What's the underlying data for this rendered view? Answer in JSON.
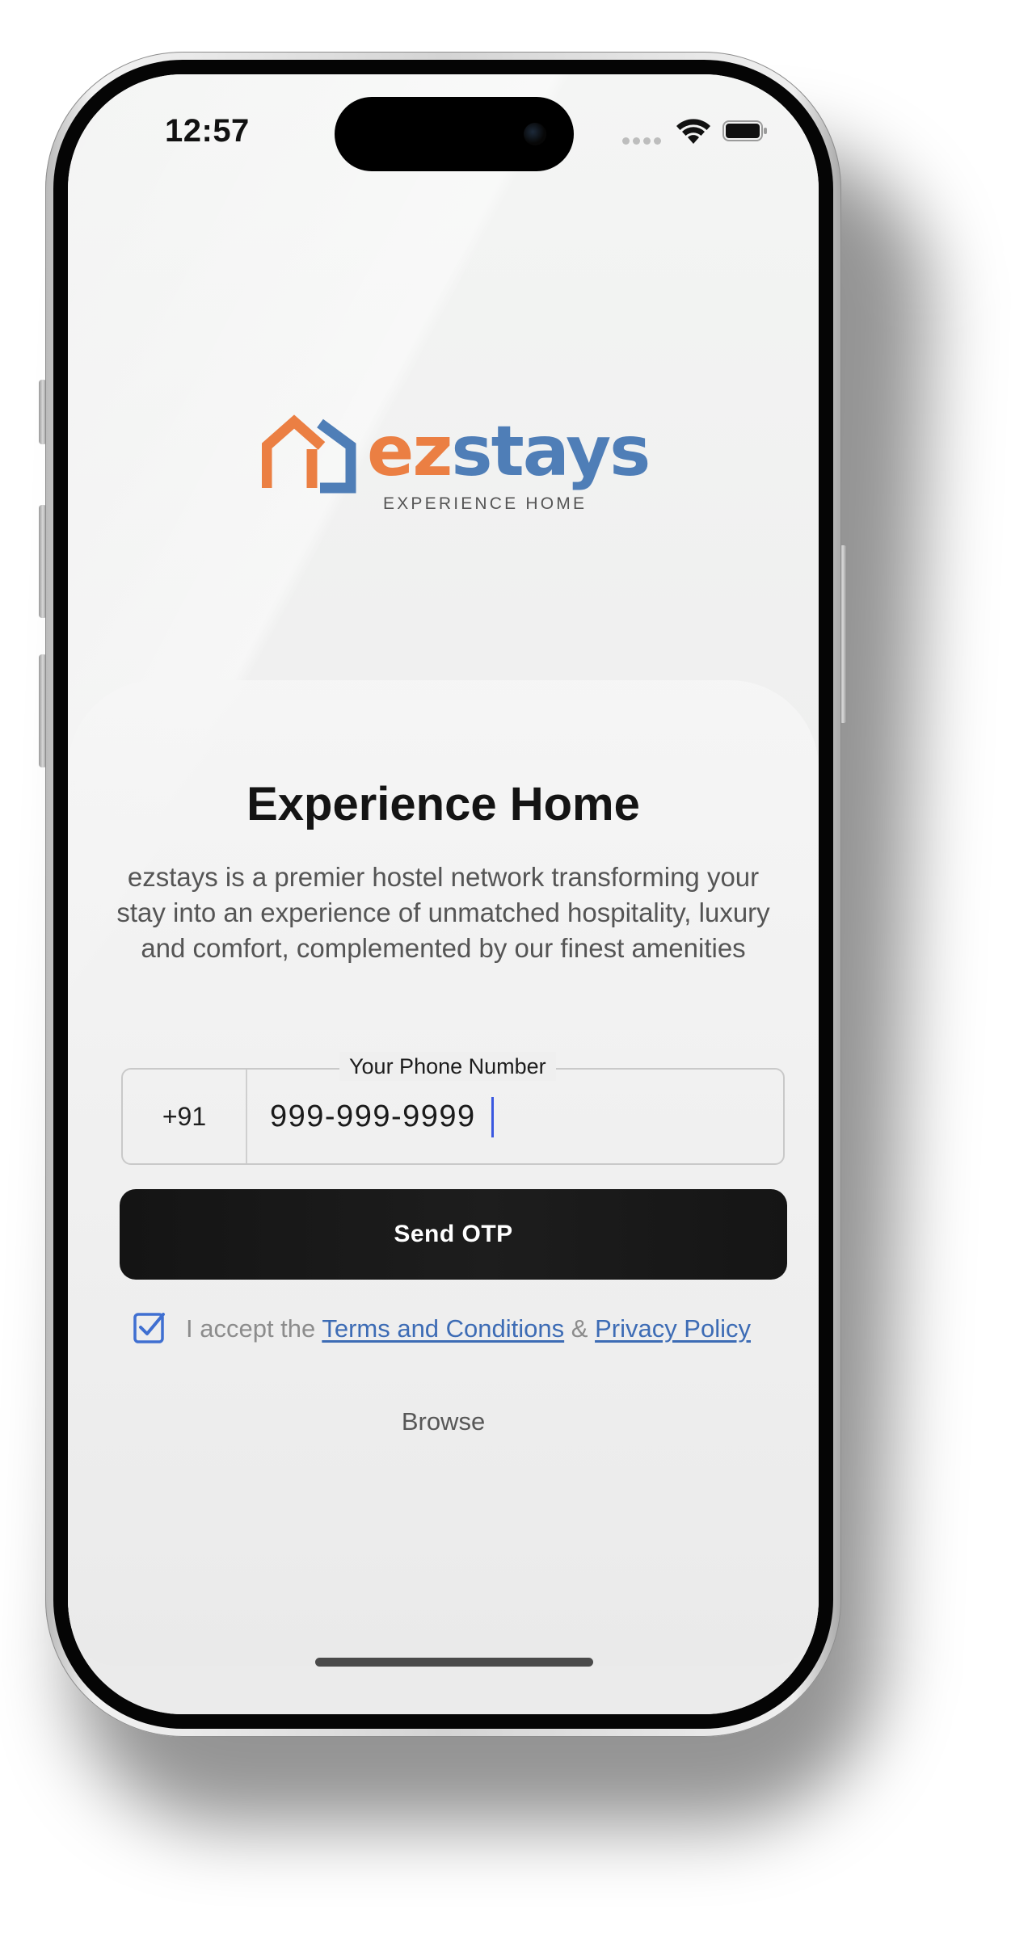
{
  "status_bar": {
    "time": "12:57"
  },
  "logo": {
    "wordmark_part1": "ez",
    "wordmark_part2": "stays",
    "tagline": "EXPERIENCE HOME"
  },
  "main": {
    "title": "Experience Home",
    "description": "ezstays is a premier hostel network transforming your stay into an experience of unmatched hospitality, luxury and comfort, complemented by our finest amenities"
  },
  "phone_field": {
    "label": "Your Phone Number",
    "country_code": "+91",
    "value": "999-999-9999"
  },
  "send_button": {
    "label": "Send OTP"
  },
  "terms": {
    "checked": true,
    "prefix": "I accept the ",
    "terms_link": "Terms and Conditions",
    "separator": " & ",
    "privacy_link": "Privacy Policy"
  },
  "browse": {
    "label": "Browse"
  },
  "colors": {
    "brand_orange": "#eb7f43",
    "brand_blue": "#4f7eb7",
    "link_blue": "#3d6cb5",
    "button_black": "#161616"
  },
  "icons": {
    "logo": "house-icon",
    "wifi": "wifi-icon",
    "battery": "battery-icon",
    "signal": "cellular-signal-icon",
    "checkbox": "checkbox-checked-icon"
  }
}
